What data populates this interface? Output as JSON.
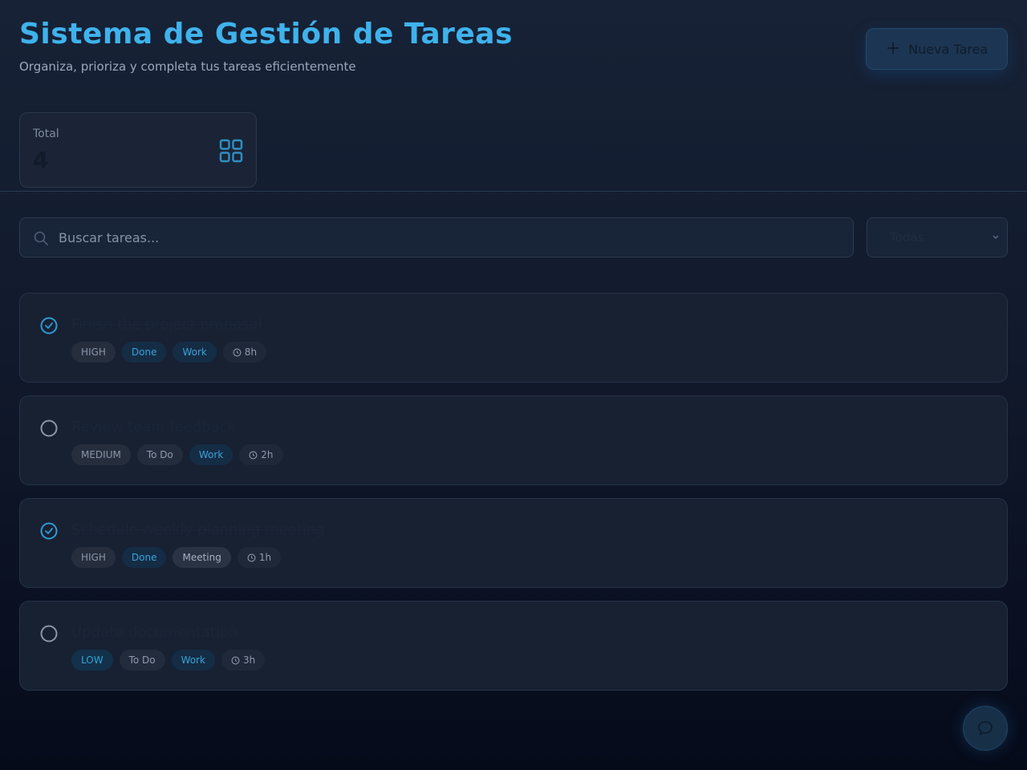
{
  "header": {
    "title": "Sistema de Gestión de Tareas",
    "subtitle": "Organiza, prioriza y completa tus tareas eficientemente",
    "new_task_label": "Nueva Tarea"
  },
  "stats": {
    "total_label": "Total",
    "total_value": "4"
  },
  "search": {
    "placeholder": "Buscar tareas...",
    "value": ""
  },
  "filter": {
    "selected": "Todas"
  },
  "tasks": [
    {
      "title": "Finish the project proposal",
      "done": true,
      "priority": "HIGH",
      "status": "Done",
      "category": "Work",
      "time": "8h"
    },
    {
      "title": "Review team feedback",
      "done": false,
      "priority": "MEDIUM",
      "status": "To Do",
      "category": "Work",
      "time": "2h"
    },
    {
      "title": "Schedule weekly planning meeting",
      "done": true,
      "priority": "HIGH",
      "status": "Done",
      "category": "Meeting",
      "time": "1h"
    },
    {
      "title": "Update documentation",
      "done": false,
      "priority": "LOW",
      "status": "To Do",
      "category": "Work",
      "time": "3h"
    }
  ],
  "colors": {
    "accent": "#3fb2ec",
    "background": "#111a2c",
    "card": "#172132"
  },
  "icons": {
    "new_task": "plus-icon",
    "stats": "grid-icon",
    "search": "search-icon",
    "filter": "chevron-down-icon",
    "task_done": "check-circle-icon",
    "task_open": "circle-icon",
    "time": "clock-icon",
    "fab": "chat-icon"
  }
}
